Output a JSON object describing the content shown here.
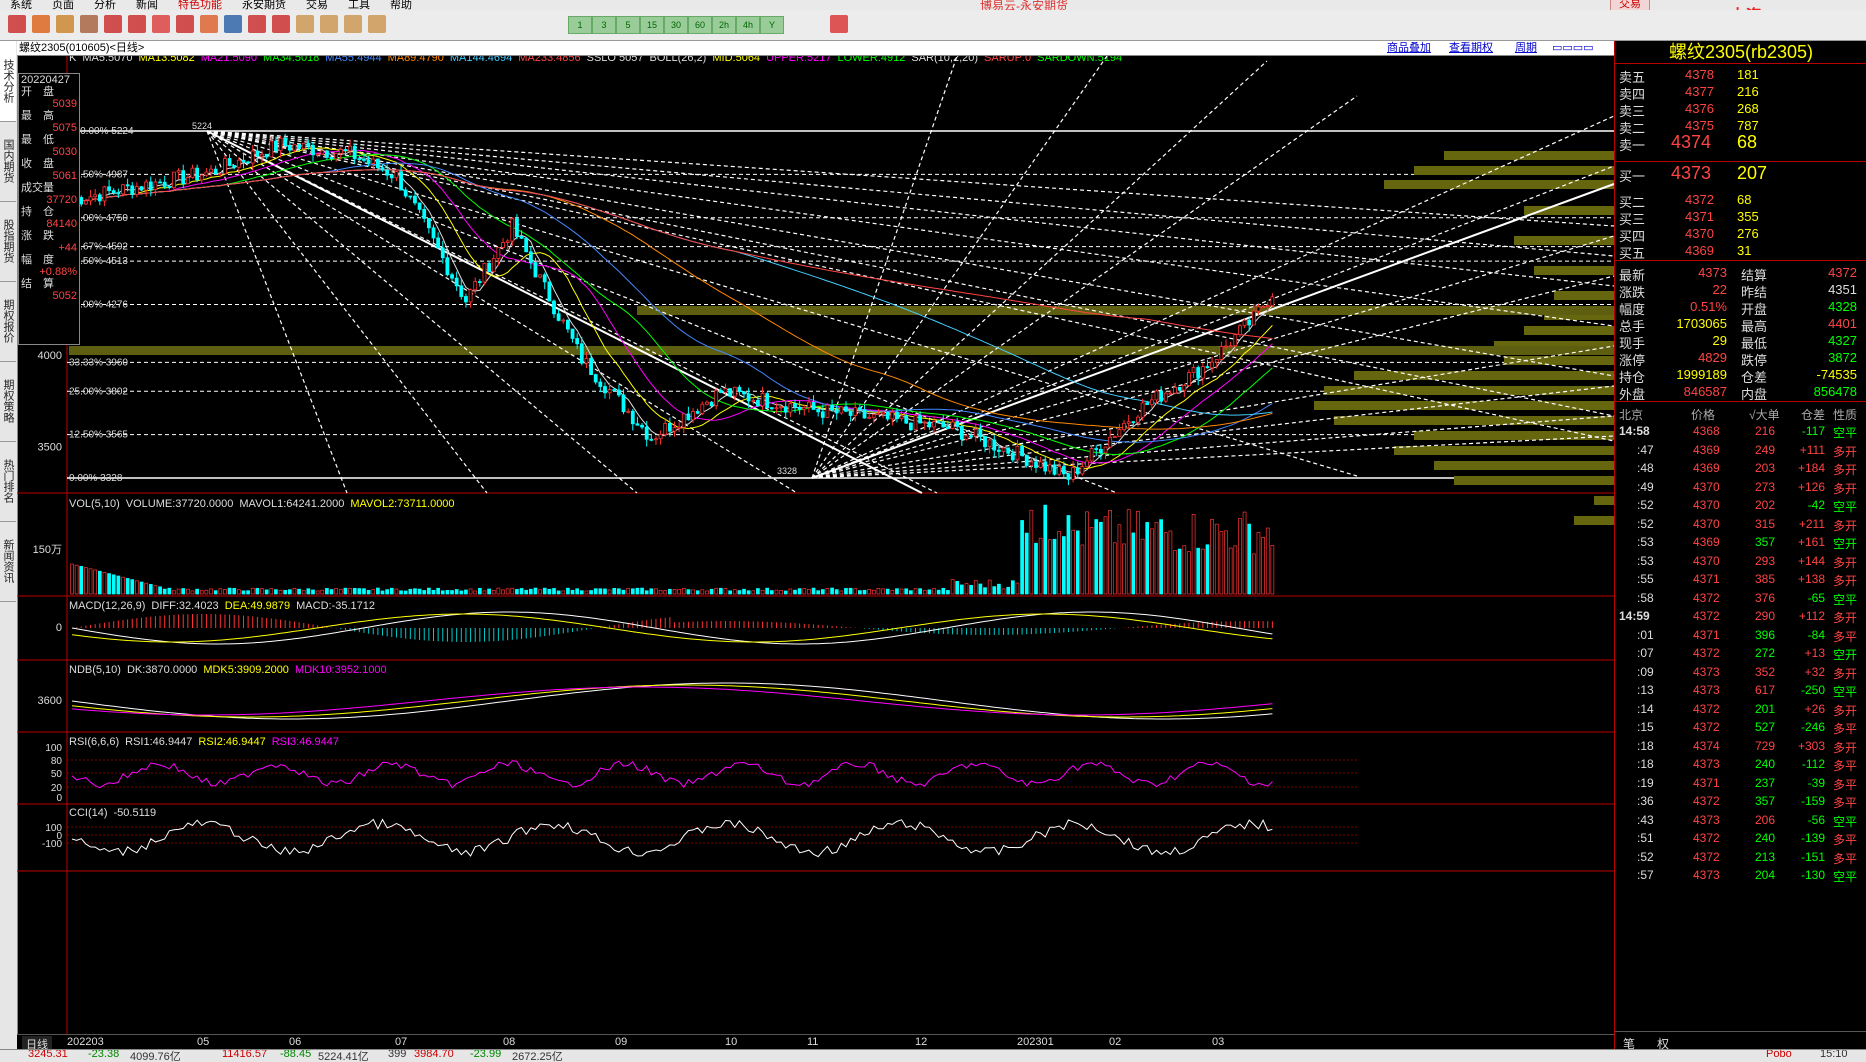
{
  "menu": [
    "系统",
    "页面",
    "分析",
    "新闻",
    "特色功能",
    "永安期货",
    "交易",
    "工具",
    "帮助"
  ],
  "app_title": "博易云-永安期货",
  "trade_button": "交易",
  "watermark": "5E大资5etz.com",
  "toolbar_labels": [
    "1",
    "3",
    "5",
    "15",
    "30",
    "60",
    "2h",
    "4h",
    "Y"
  ],
  "left_tabs": [
    "技术分析",
    "国内期货",
    "股指期货",
    "期权报价",
    "期权策略",
    "热门排名",
    "新闻资讯"
  ],
  "chart_header": {
    "symbol": "螺纹2305(010605)<日线>",
    "links": [
      "商品叠加",
      "查看期权",
      "周期"
    ]
  },
  "ma_line": [
    {
      "text": "K",
      "color": "#ddd"
    },
    {
      "text": "MA5:5070",
      "color": "#ddd"
    },
    {
      "text": "MA13:5082",
      "color": "#ff0"
    },
    {
      "text": "MA21:5090",
      "color": "#f0f"
    },
    {
      "text": "MA34:5018",
      "color": "#0f0"
    },
    {
      "text": "MA55:4944",
      "color": "#48f"
    },
    {
      "text": "MA89:4790",
      "color": "#f80"
    },
    {
      "text": "MA144:4694",
      "color": "#4cf"
    },
    {
      "text": "MA233:4856",
      "color": "#f44"
    },
    {
      "text": "SSLO 5057",
      "color": "#ddd"
    },
    {
      "text": "BOLL(26,2)",
      "color": "#ddd"
    },
    {
      "text": "MID:5064",
      "color": "#ff0"
    },
    {
      "text": "UPPER:5217",
      "color": "#f0f"
    },
    {
      "text": "LOWER:4912",
      "color": "#0f0"
    },
    {
      "text": "SAR(10,2,20)",
      "color": "#ddd"
    },
    {
      "text": "SARUP:0",
      "color": "#f44"
    },
    {
      "text": "SARDOWN:5194",
      "color": "#0f0"
    }
  ],
  "infobox": [
    {
      "label": "20220427",
      "value": ""
    },
    {
      "label": "开　盘",
      "value": "5039"
    },
    {
      "label": "最　高",
      "value": "5075"
    },
    {
      "label": "最　低",
      "value": "5030"
    },
    {
      "label": "收　盘",
      "value": "5061"
    },
    {
      "label": "成交量",
      "value": "37720"
    },
    {
      "label": "持　仓",
      "value": "84140"
    },
    {
      "label": "涨　跌",
      "value": "+44"
    },
    {
      "label": "幅　度",
      "value": "+0.88%"
    },
    {
      "label": "结　算",
      "value": "5052"
    }
  ],
  "fib_levels": [
    {
      "text": "100.00% 5224",
      "price": 5224
    },
    {
      "text": "87.50% 4987",
      "price": 4987
    },
    {
      "text": "75.00% 4750",
      "price": 4750
    },
    {
      "text": "66.67% 4592",
      "price": 4592
    },
    {
      "text": "62.50% 4513",
      "price": 4513
    },
    {
      "text": "50.00% 4276",
      "price": 4276
    },
    {
      "text": "33.33% 3960",
      "price": 3960
    },
    {
      "text": "25.00% 3802",
      "price": 3802
    },
    {
      "text": "12.50% 3565",
      "price": 3565
    },
    {
      "text": "0.00% 3328",
      "price": 3328
    }
  ],
  "price_axis": [
    "4000",
    "3500"
  ],
  "peak_label": "5224",
  "trough_label": "3328",
  "vol_header": [
    {
      "text": "VOL(5,10)",
      "color": "#ddd"
    },
    {
      "text": "VOLUME:37720.0000",
      "color": "#ddd"
    },
    {
      "text": "MAVOL1:64241.2000",
      "color": "#ddd"
    },
    {
      "text": "MAVOL2:73711.0000",
      "color": "#ff0"
    }
  ],
  "vol_axis": "150万",
  "macd_header": [
    {
      "text": "MACD(12,26,9)",
      "color": "#ddd"
    },
    {
      "text": "DIFF:32.4023",
      "color": "#ddd"
    },
    {
      "text": "DEA:49.9879",
      "color": "#ff0"
    },
    {
      "text": "MACD:-35.1712",
      "color": "#ddd"
    }
  ],
  "macd_axis": "0",
  "ndb_header": [
    {
      "text": "NDB(5,10)",
      "color": "#ddd"
    },
    {
      "text": "DK:3870.0000",
      "color": "#ddd"
    },
    {
      "text": "MDK5:3909.2000",
      "color": "#ff0"
    },
    {
      "text": "MDK10:3952.1000",
      "color": "#f0f"
    }
  ],
  "ndb_axis": "3600",
  "rsi_header": [
    {
      "text": "RSI(6,6,6)",
      "color": "#ddd"
    },
    {
      "text": "RSI1:46.9447",
      "color": "#ddd"
    },
    {
      "text": "RSI2:46.9447",
      "color": "#ff0"
    },
    {
      "text": "RSI3:46.9447",
      "color": "#f0f"
    }
  ],
  "rsi_axis": [
    "100",
    "80",
    "50",
    "20",
    "0"
  ],
  "cci_header": [
    {
      "text": "CCI(14)",
      "color": "#ddd"
    },
    {
      "text": "-50.5119",
      "color": "#ddd"
    }
  ],
  "cci_axis": [
    "100",
    "0",
    "-100"
  ],
  "bottom_tabs": [
    "日线",
    "202203",
    "05",
    "06",
    "07",
    "08",
    "09",
    "10",
    "11",
    "12",
    "202301",
    "02",
    "03"
  ],
  "quote": {
    "title": "螺纹2305(rb2305)",
    "asks": [
      {
        "label": "卖五",
        "price": "4378",
        "vol": "181"
      },
      {
        "label": "卖四",
        "price": "4377",
        "vol": "216"
      },
      {
        "label": "卖三",
        "price": "4376",
        "vol": "268"
      },
      {
        "label": "卖二",
        "price": "4375",
        "vol": "787"
      },
      {
        "label": "卖一",
        "price": "4374",
        "vol": "68"
      }
    ],
    "bids": [
      {
        "label": "买一",
        "price": "4373",
        "vol": "207"
      },
      {
        "label": "买二",
        "price": "4372",
        "vol": "68"
      },
      {
        "label": "买三",
        "price": "4371",
        "vol": "355"
      },
      {
        "label": "买四",
        "price": "4370",
        "vol": "276"
      },
      {
        "label": "买五",
        "price": "4369",
        "vol": "31"
      }
    ],
    "stats": [
      {
        "l1": "最新",
        "v1": "4373",
        "c1": "#f44",
        "l2": "结算",
        "v2": "4372",
        "c2": "#f44"
      },
      {
        "l1": "涨跌",
        "v1": "22",
        "c1": "#f44",
        "l2": "昨结",
        "v2": "4351",
        "c2": "#ddd"
      },
      {
        "l1": "幅度",
        "v1": "0.51%",
        "c1": "#f44",
        "l2": "开盘",
        "v2": "4328",
        "c2": "#0f0"
      },
      {
        "l1": "总手",
        "v1": "1703065",
        "c1": "#ff0",
        "l2": "最高",
        "v2": "4401",
        "c2": "#f44"
      },
      {
        "l1": "现手",
        "v1": "29",
        "c1": "#ff0",
        "l2": "最低",
        "v2": "4327",
        "c2": "#0f0"
      },
      {
        "l1": "涨停",
        "v1": "4829",
        "c1": "#f44",
        "l2": "跌停",
        "v2": "3872",
        "c2": "#0f0"
      },
      {
        "l1": "持仓",
        "v1": "1999189",
        "c1": "#ff0",
        "l2": "仓差",
        "v2": "-74535",
        "c2": "#ff0"
      },
      {
        "l1": "外盘",
        "v1": "846587",
        "c1": "#f44",
        "l2": "内盘",
        "v2": "856478",
        "c2": "#0f0"
      }
    ],
    "tick_header": [
      "北京",
      "价格",
      "√大单",
      "仓差",
      "性质"
    ],
    "ticks": [
      {
        "t": "14:58",
        "p": "4368",
        "v": "216",
        "d": "-117",
        "n": "空平",
        "vc": "#f44",
        "nc": "#0f0",
        "bold": true
      },
      {
        "t": ":47",
        "p": "4369",
        "v": "249",
        "d": "+111",
        "n": "多开",
        "vc": "#f44",
        "nc": "#f44"
      },
      {
        "t": ":48",
        "p": "4369",
        "v": "203",
        "d": "+184",
        "n": "多开",
        "vc": "#f44",
        "nc": "#f44"
      },
      {
        "t": ":49",
        "p": "4370",
        "v": "273",
        "d": "+126",
        "n": "多开",
        "vc": "#f44",
        "nc": "#f44"
      },
      {
        "t": ":52",
        "p": "4370",
        "v": "202",
        "d": "-42",
        "n": "空平",
        "vc": "#f44",
        "nc": "#0f0"
      },
      {
        "t": ":52",
        "p": "4370",
        "v": "315",
        "d": "+211",
        "n": "多开",
        "vc": "#f44",
        "nc": "#f44"
      },
      {
        "t": ":53",
        "p": "4369",
        "v": "357",
        "d": "+161",
        "n": "空开",
        "vc": "#0f0",
        "nc": "#0f0"
      },
      {
        "t": ":53",
        "p": "4370",
        "v": "293",
        "d": "+144",
        "n": "多开",
        "vc": "#f44",
        "nc": "#f44"
      },
      {
        "t": ":55",
        "p": "4371",
        "v": "385",
        "d": "+138",
        "n": "多开",
        "vc": "#f44",
        "nc": "#f44"
      },
      {
        "t": ":58",
        "p": "4372",
        "v": "376",
        "d": "-65",
        "n": "空平",
        "vc": "#f44",
        "nc": "#0f0"
      },
      {
        "t": "14:59",
        "p": "4372",
        "v": "290",
        "d": "+112",
        "n": "多开",
        "vc": "#f44",
        "nc": "#f44",
        "bold": true
      },
      {
        "t": ":01",
        "p": "4371",
        "v": "396",
        "d": "-84",
        "n": "多平",
        "vc": "#0f0",
        "nc": "#f44"
      },
      {
        "t": ":07",
        "p": "4372",
        "v": "272",
        "d": "+13",
        "n": "空开",
        "vc": "#0f0",
        "nc": "#0f0"
      },
      {
        "t": ":09",
        "p": "4373",
        "v": "352",
        "d": "+32",
        "n": "多开",
        "vc": "#f44",
        "nc": "#f44"
      },
      {
        "t": ":13",
        "p": "4373",
        "v": "617",
        "d": "-250",
        "n": "空平",
        "vc": "#f44",
        "nc": "#0f0"
      },
      {
        "t": ":14",
        "p": "4372",
        "v": "201",
        "d": "+26",
        "n": "多开",
        "vc": "#0f0",
        "nc": "#f44"
      },
      {
        "t": ":15",
        "p": "4372",
        "v": "527",
        "d": "-246",
        "n": "多平",
        "vc": "#0f0",
        "nc": "#f44"
      },
      {
        "t": ":18",
        "p": "4374",
        "v": "729",
        "d": "+303",
        "n": "多开",
        "vc": "#f44",
        "nc": "#f44"
      },
      {
        "t": ":18",
        "p": "4373",
        "v": "240",
        "d": "-112",
        "n": "多平",
        "vc": "#0f0",
        "nc": "#f44"
      },
      {
        "t": ":19",
        "p": "4371",
        "v": "237",
        "d": "-39",
        "n": "多平",
        "vc": "#0f0",
        "nc": "#f44"
      },
      {
        "t": ":36",
        "p": "4372",
        "v": "357",
        "d": "-159",
        "n": "多平",
        "vc": "#0f0",
        "nc": "#f44"
      },
      {
        "t": ":43",
        "p": "4373",
        "v": "206",
        "d": "-56",
        "n": "空平",
        "vc": "#f44",
        "nc": "#0f0"
      },
      {
        "t": ":51",
        "p": "4372",
        "v": "240",
        "d": "-139",
        "n": "多平",
        "vc": "#0f0",
        "nc": "#f44"
      },
      {
        "t": ":52",
        "p": "4372",
        "v": "213",
        "d": "-151",
        "n": "多平",
        "vc": "#0f0",
        "nc": "#f44"
      },
      {
        "t": ":57",
        "p": "4373",
        "v": "204",
        "d": "-130",
        "n": "空平",
        "vc": "#0f0",
        "nc": "#0f0"
      }
    ],
    "bottom": [
      "笔",
      "权"
    ]
  },
  "statusbar": [
    {
      "text": "3245.31",
      "color": "#c00"
    },
    {
      "text": "-23.38",
      "color": "#080"
    },
    {
      "text": "4099.76亿",
      "color": "#333"
    },
    {
      "text": "11416.57",
      "color": "#c00"
    },
    {
      "text": "-88.45",
      "color": "#080"
    },
    {
      "text": "5224.41亿",
      "color": "#333"
    },
    {
      "text": "399",
      "color": "#333"
    },
    {
      "text": "3984.70",
      "color": "#c00"
    },
    {
      "text": "-23.99",
      "color": "#080"
    },
    {
      "text": "2672.25亿",
      "color": "#333"
    },
    {
      "text": "Pobo",
      "color": "#c00"
    },
    {
      "text": "15:10",
      "color": "#333"
    }
  ],
  "chart_data": {
    "type": "candlestick",
    "series": [
      {
        "name": "MA5",
        "color": "#ddd"
      },
      {
        "name": "MA13",
        "color": "#ff0"
      },
      {
        "name": "MA21",
        "color": "#f0f"
      },
      {
        "name": "MA34",
        "color": "#0f0"
      },
      {
        "name": "MA55",
        "color": "#48f"
      },
      {
        "name": "MA89",
        "color": "#f80"
      },
      {
        "name": "MA144",
        "color": "#4cf"
      },
      {
        "name": "MA233",
        "color": "#f44"
      }
    ],
    "price_range": [
      3328,
      5224
    ],
    "x_months": [
      "202203",
      "05",
      "06",
      "07",
      "08",
      "09",
      "10",
      "11",
      "12",
      "202301",
      "02",
      "03"
    ]
  }
}
